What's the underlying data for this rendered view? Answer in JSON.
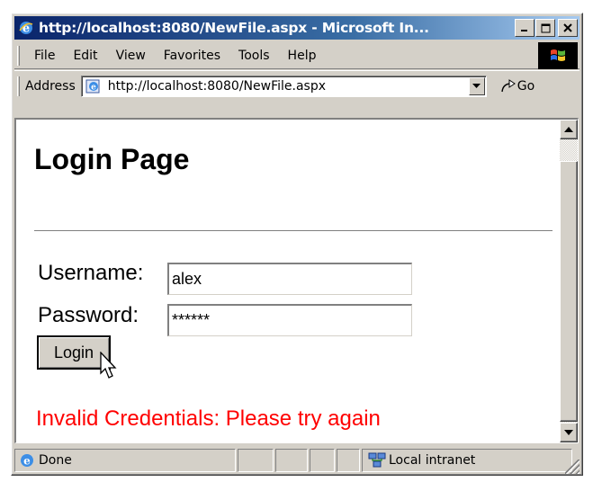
{
  "window": {
    "title": "http://localhost:8080/NewFile.aspx - Microsoft In..."
  },
  "menu": {
    "items": [
      "File",
      "Edit",
      "View",
      "Favorites",
      "Tools",
      "Help"
    ]
  },
  "address": {
    "label": "Address",
    "url": "http://localhost:8080/NewFile.aspx",
    "go_label": "Go"
  },
  "page": {
    "heading": "Login Page",
    "username_label": "Username:",
    "username_value": "alex",
    "password_label": "Password:",
    "password_value": "******",
    "login_label": "Login",
    "error_message": "Invalid Credentials: Please try again"
  },
  "status": {
    "text": "Done",
    "zone": "Local intranet"
  },
  "colors": {
    "error": "#ff0000",
    "titlebar_start": "#0a246a",
    "titlebar_end": "#a6caf0",
    "chrome": "#d4d0c8"
  },
  "icons": [
    "ie-icon",
    "minimize-icon",
    "maximize-icon",
    "close-icon",
    "windows-logo-icon",
    "page-icon",
    "dropdown-arrow-icon",
    "go-arrow-icon",
    "scroll-up-icon",
    "scroll-down-icon",
    "mouse-cursor-icon",
    "local-intranet-icon"
  ]
}
